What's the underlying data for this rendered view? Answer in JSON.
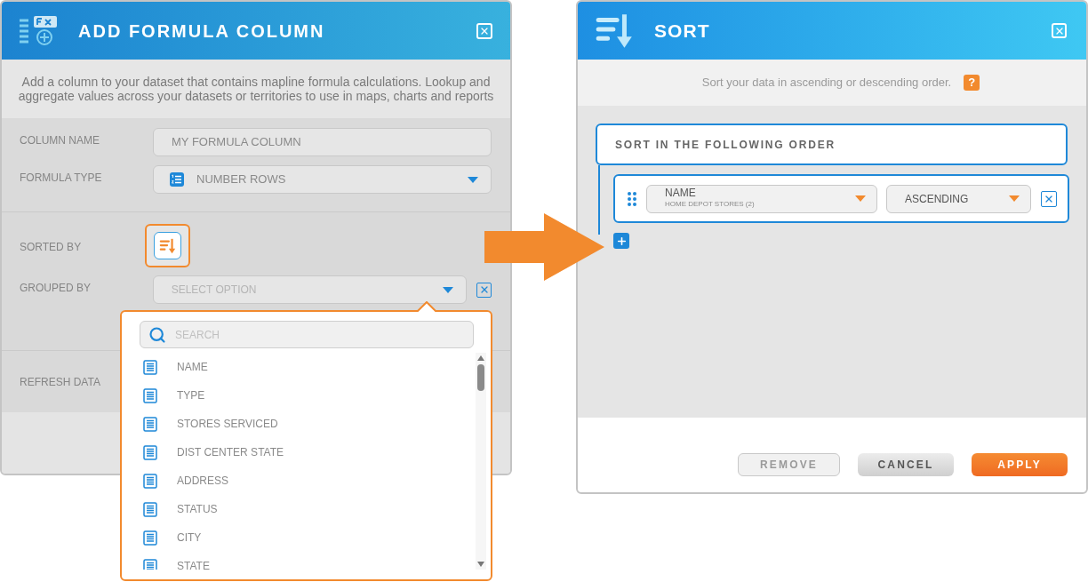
{
  "formula_dialog": {
    "title": "ADD FORMULA COLUMN",
    "description": "Add a column to your dataset that contains mapline formula calculations. Lookup and aggregate values across your datasets or territories to use in maps, charts and reports",
    "fields": [
      {
        "kind": "text",
        "label": "COLUMN NAME",
        "value": "MY FORMULA COLUMN"
      },
      {
        "kind": "select",
        "label": "FORMULA TYPE",
        "value": "NUMBER ROWS"
      }
    ],
    "sorted_by": {
      "label": "SORTED BY",
      "selected": true
    },
    "grouped_by": {
      "label": "GROUPED BY",
      "placeholder": "SELECT OPTION",
      "expanded": true
    },
    "refresh_data": {
      "label": "REFRESH DATA"
    }
  },
  "dropdown": {
    "search": {
      "placeholder": "SEARCH"
    },
    "items": [
      {
        "label": "NAME"
      },
      {
        "label": "TYPE"
      },
      {
        "label": "STORES SERVICED"
      },
      {
        "label": "DIST CENTER STATE"
      },
      {
        "label": "ADDRESS"
      },
      {
        "label": "STATUS"
      },
      {
        "label": "CITY"
      },
      {
        "label": "STATE"
      }
    ]
  },
  "sort_dialog": {
    "title": "SORT",
    "description": "Sort your data in ascending or descending order.",
    "help": "?",
    "section_title": "SORT IN THE FOLLOWING ORDER",
    "rules": [
      {
        "field": "NAME",
        "dataset": "HOME DEPOT STORES (2)",
        "direction": "ASCENDING"
      }
    ],
    "buttons": [
      {
        "label": "REMOVE",
        "kind": "disabled"
      },
      {
        "label": "CANCEL",
        "kind": "secondary"
      },
      {
        "label": "APPLY",
        "kind": "primary"
      }
    ]
  }
}
